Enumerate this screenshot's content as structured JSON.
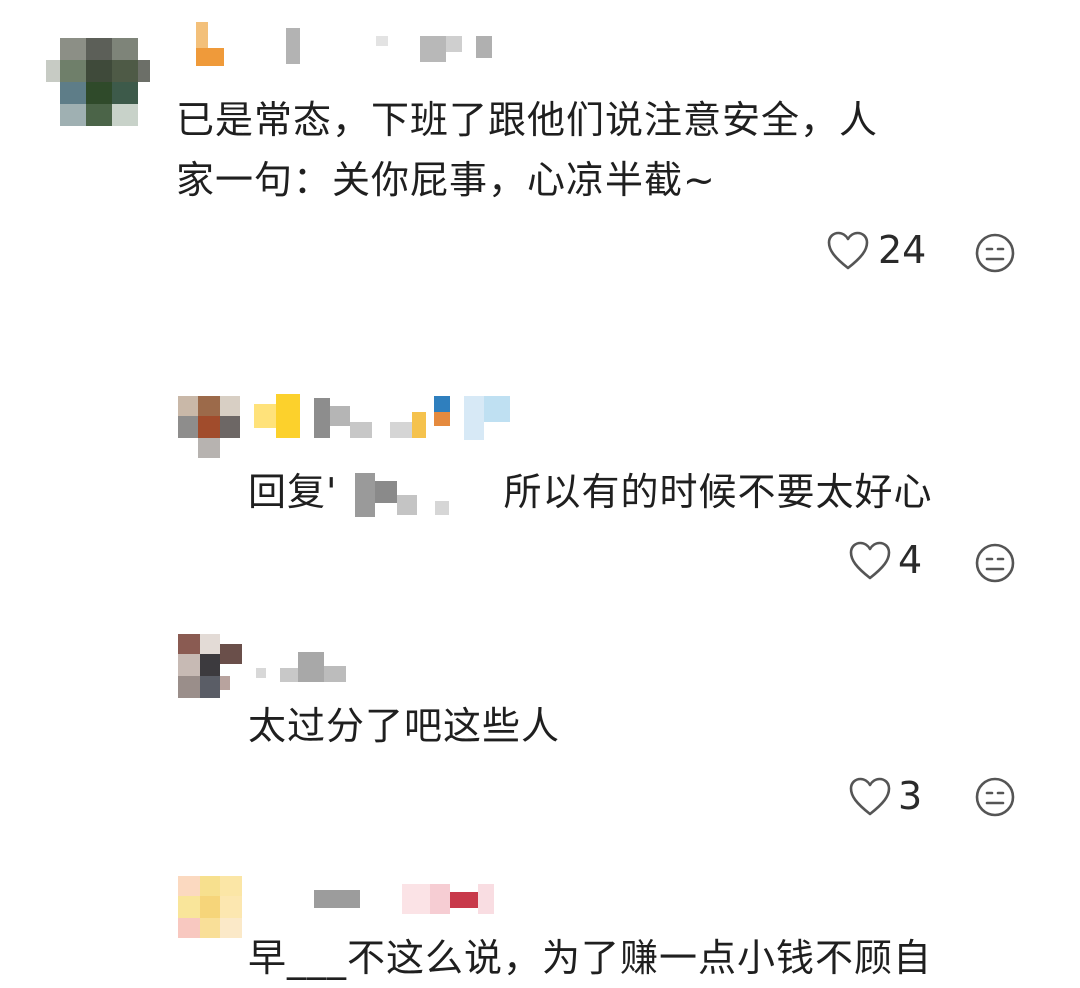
{
  "comments": [
    {
      "id": "c1",
      "text_line1": "已是常态，下班了跟他们说注意安全，人",
      "text_line2": "家一句：关你屁事，心凉半截~",
      "likes": "24"
    },
    {
      "id": "c2",
      "reply_prefix": "回复'",
      "reply_text": "所以有的时候不要太好心",
      "likes": "4"
    },
    {
      "id": "c3",
      "text": "太过分了吧这些人",
      "likes": "3"
    },
    {
      "id": "c4",
      "text": "早___不这么说，为了赚一点小钱不顾自"
    }
  ],
  "icons": {
    "like": "heart-outline-icon",
    "react": "expressionless-face-icon"
  },
  "colors": {
    "text": "#1f1f1f",
    "icon": "#555555"
  }
}
